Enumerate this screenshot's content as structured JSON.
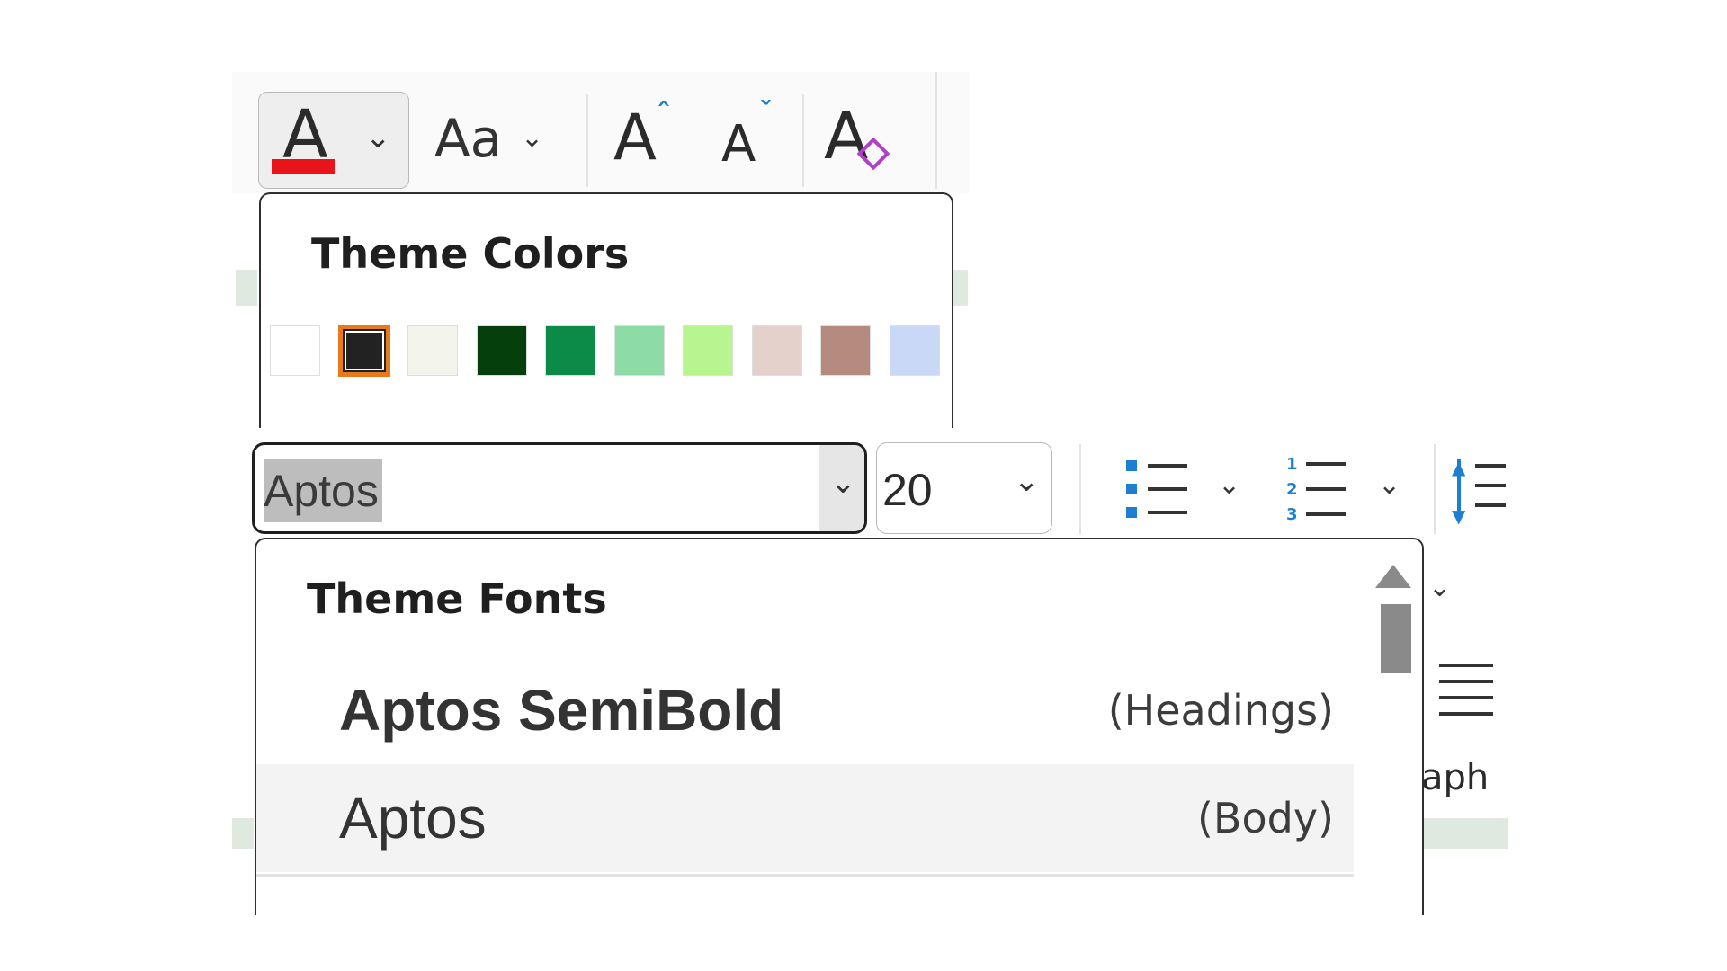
{
  "toolbar_top": {
    "font_color_glyph": "A",
    "font_color_accent": "#e8141a",
    "change_case_label": "Aa",
    "grow_font_glyph": "A",
    "shrink_font_glyph": "A",
    "clear_format_glyph": "A",
    "icons": [
      "font-color-icon",
      "chevron-down-icon",
      "change-case-icon",
      "grow-font-icon",
      "shrink-font-icon",
      "clear-formatting-icon"
    ]
  },
  "theme_colors": {
    "title": "Theme Colors",
    "swatches": [
      {
        "name": "white",
        "color": "#ffffff",
        "selected": false
      },
      {
        "name": "black",
        "color": "#222222",
        "selected": true
      },
      {
        "name": "off-white",
        "color": "#f3f4ec",
        "selected": false
      },
      {
        "name": "dark-green",
        "color": "#053f0b",
        "selected": false
      },
      {
        "name": "green",
        "color": "#0c8a47",
        "selected": false
      },
      {
        "name": "light-green",
        "color": "#8edca5",
        "selected": false
      },
      {
        "name": "lime",
        "color": "#b7f58f",
        "selected": false
      },
      {
        "name": "blush",
        "color": "#e4d1cb",
        "selected": false
      },
      {
        "name": "taupe",
        "color": "#b48b7e",
        "selected": false
      },
      {
        "name": "light-blue",
        "color": "#c9d8f6",
        "selected": false
      }
    ],
    "selection_color": "#e87a1b"
  },
  "font_controls": {
    "font_name": "Aptos",
    "font_size": "20"
  },
  "paragraph_partial": {
    "label_fragment": "aph"
  },
  "theme_fonts": {
    "title": "Theme Fonts",
    "items": [
      {
        "name": "Aptos SemiBold",
        "tag": "(Headings)"
      },
      {
        "name": "Aptos",
        "tag": "(Body)"
      }
    ]
  }
}
